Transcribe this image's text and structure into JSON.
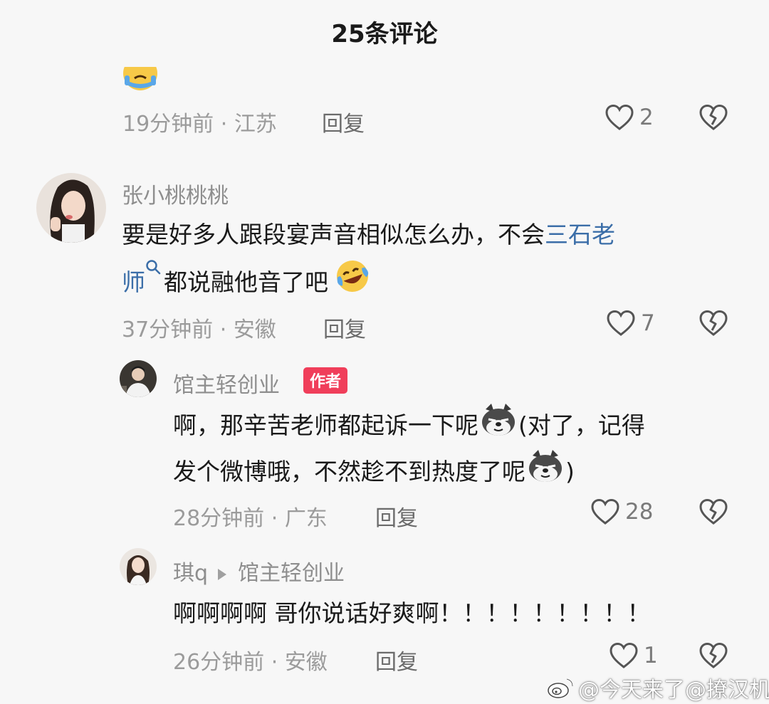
{
  "header": {
    "title": "25条评论"
  },
  "comments": [
    {
      "time": "19分钟前",
      "location": "江苏",
      "reply_label": "回复",
      "likes": "2"
    },
    {
      "username": "张小桃桃桃",
      "content_part1": "要是好多人跟段宴声音相似怎么办，不会",
      "content_link_a": "三石老",
      "content_link_b": "师",
      "content_part2": "都说融他音了吧",
      "time": "37分钟前",
      "location": "安徽",
      "reply_label": "回复",
      "likes": "7",
      "replies": [
        {
          "username": "馆主轻创业",
          "badge": "作者",
          "content_line1": "啊，那辛苦老师都起诉一下呢",
          "content_line1_tail": "(对了，记得",
          "content_line2": "发个微博哦，不然趁不到热度了呢",
          "content_line2_tail": ")",
          "time": "28分钟前",
          "location": "广东",
          "reply_label": "回复",
          "likes": "28"
        },
        {
          "username": "琪q",
          "reply_to": "馆主轻创业",
          "content": "啊啊啊啊 哥你说话好爽啊！！！！！！！！！",
          "time": "26分钟前",
          "location": "安徽",
          "reply_label": "回复",
          "likes": "1"
        }
      ]
    }
  ],
  "watermark": "@今天来了@撩汉机",
  "colors": {
    "link": "#3b6ea8",
    "author_badge": "#f03e5a",
    "background": "#f7f7f7"
  },
  "icons": [
    "heart-outline-icon",
    "broken-heart-icon",
    "search-icon",
    "crying-emoji",
    "laughing-crying-emoji",
    "doge-emoji",
    "weibo-icon"
  ]
}
